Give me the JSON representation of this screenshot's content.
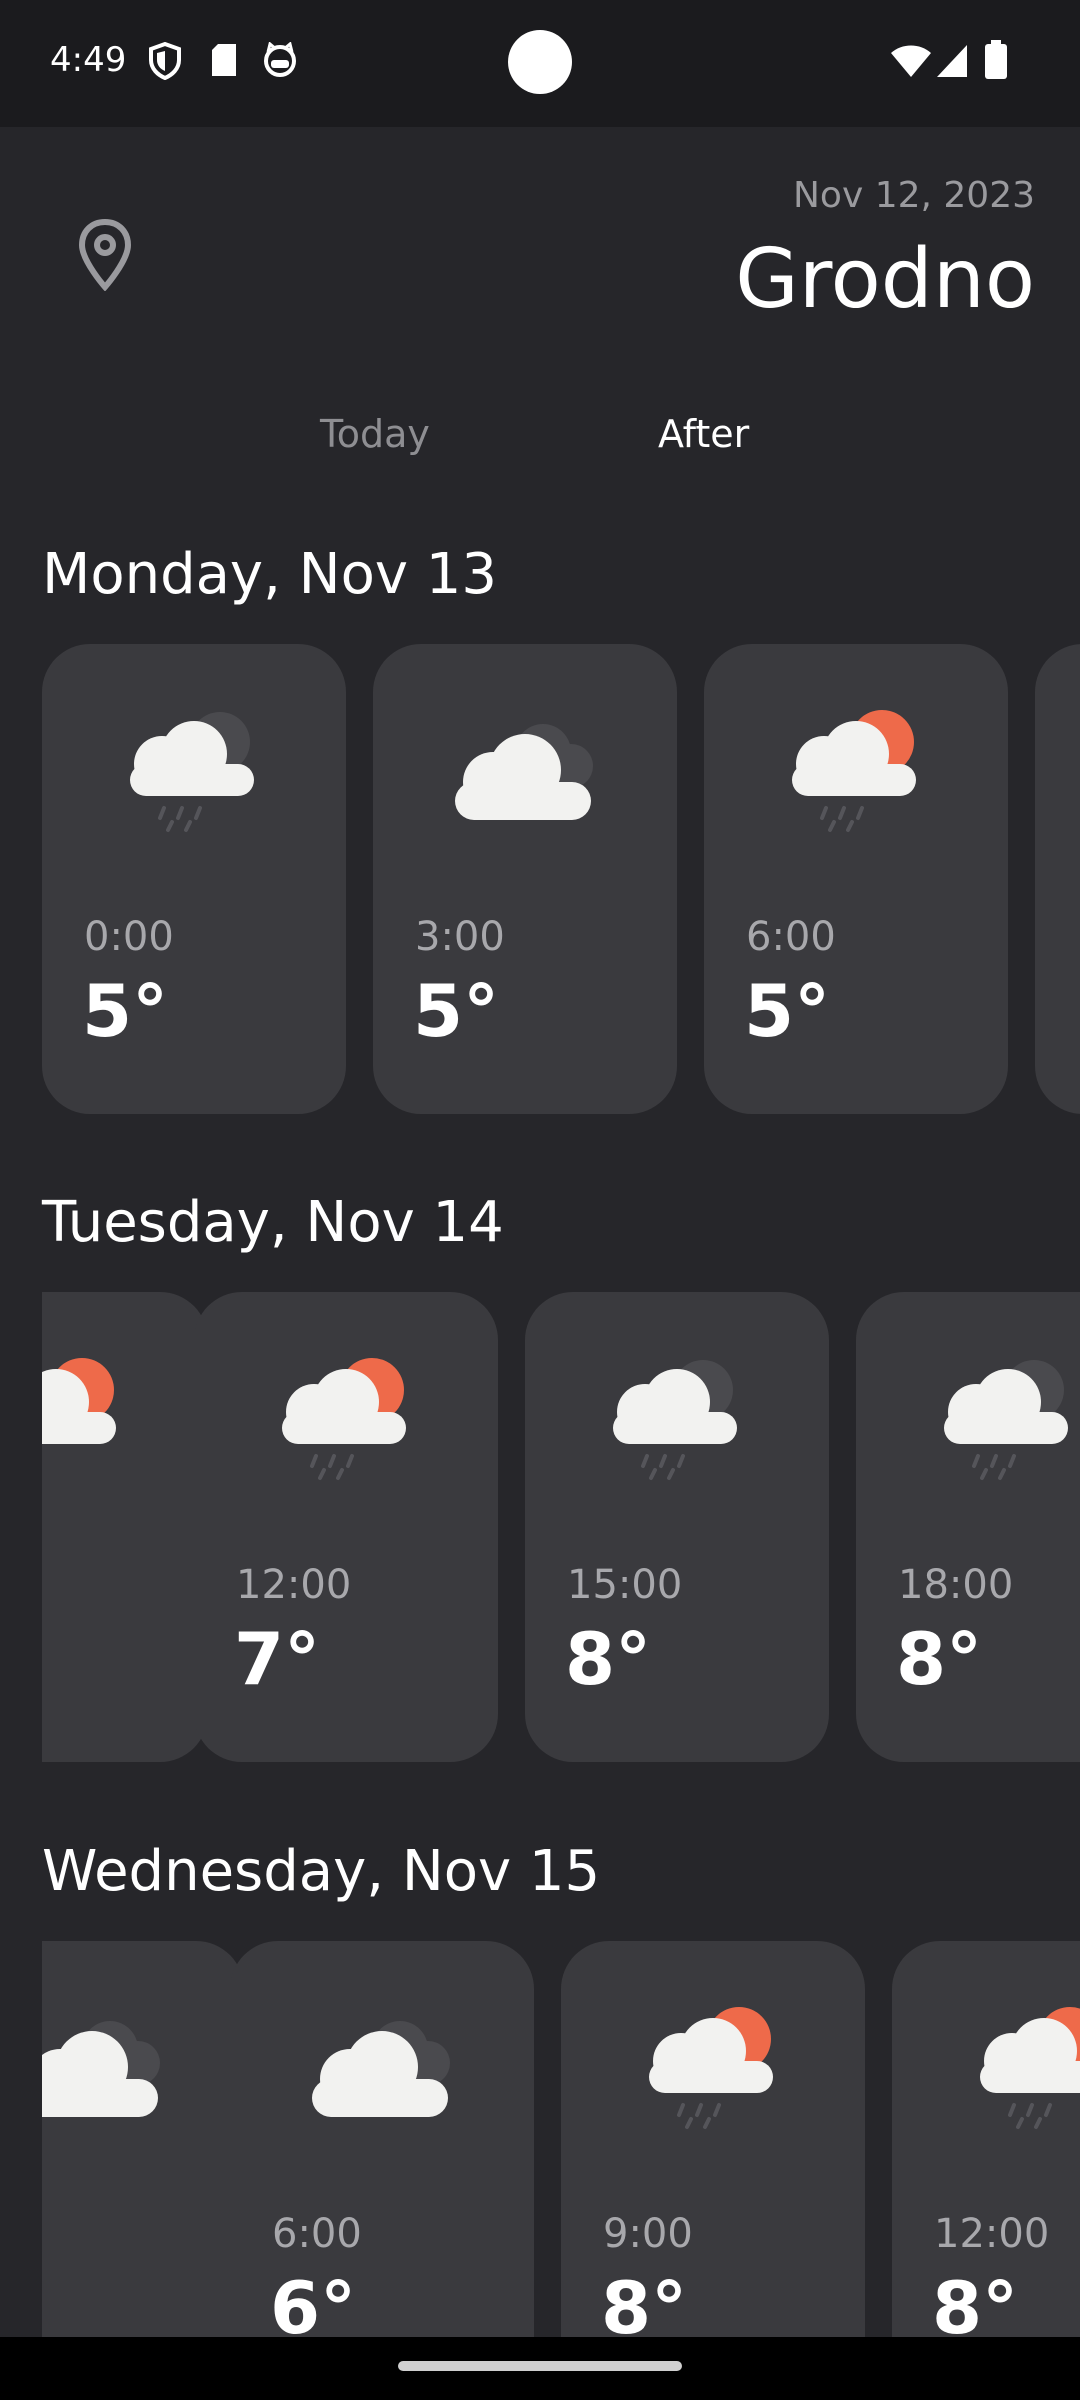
{
  "status_bar": {
    "time": "4:49",
    "icons": [
      "shield-icon",
      "sd-card-icon",
      "cat-face-icon",
      "wifi-icon",
      "cellular-icon",
      "battery-icon"
    ]
  },
  "header": {
    "date": "Nov 12, 2023",
    "city": "Grodno",
    "location_icon": "location-pin-icon"
  },
  "tabs": [
    {
      "label": "Today",
      "selected": false
    },
    {
      "label": "After",
      "selected": true
    }
  ],
  "days": [
    {
      "title": "Monday, Nov 13",
      "cards": [
        {
          "time": "0:00",
          "temp": "5°",
          "icon": "cloud-moon-rain-icon"
        },
        {
          "time": "3:00",
          "temp": "5°",
          "icon": "cloudy-icon"
        },
        {
          "time": "6:00",
          "temp": "5°",
          "icon": "cloud-sun-rain-icon"
        }
      ]
    },
    {
      "title": "Tuesday, Nov 14",
      "cards": [
        {
          "time": "",
          "temp": "",
          "icon": "cloud-sun-icon"
        },
        {
          "time": "12:00",
          "temp": "7°",
          "icon": "cloud-sun-rain-icon"
        },
        {
          "time": "15:00",
          "temp": "8°",
          "icon": "cloud-moon-rain-icon"
        },
        {
          "time": "18:00",
          "temp": "8°",
          "icon": "cloud-moon-rain-icon"
        }
      ]
    },
    {
      "title": "Wednesday, Nov 15",
      "cards": [
        {
          "time": "",
          "temp": "",
          "icon": "cloudy-icon"
        },
        {
          "time": "6:00",
          "temp": "6°",
          "icon": "cloudy-icon"
        },
        {
          "time": "9:00",
          "temp": "8°",
          "icon": "cloud-sun-rain-icon"
        },
        {
          "time": "12:00",
          "temp": "8°",
          "icon": "cloud-sun-rain-icon"
        }
      ]
    }
  ],
  "colors": {
    "background": "#26262a",
    "card": "#3a3a3e",
    "sun": "#ee6a4a",
    "cloud": "#f2f2f0",
    "moon": "#4a4a4e"
  }
}
